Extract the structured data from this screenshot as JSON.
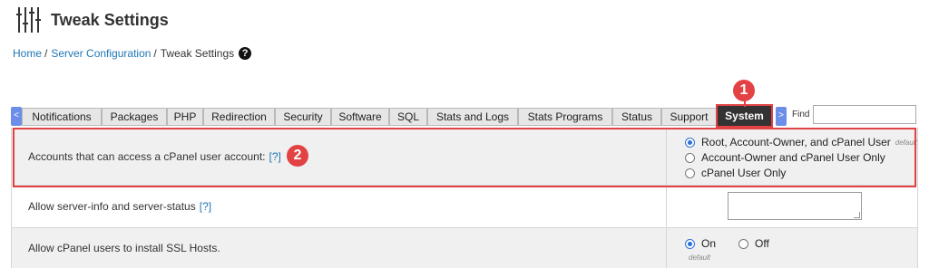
{
  "header": {
    "title": "Tweak Settings",
    "icon": "sliders-icon"
  },
  "breadcrumb": {
    "home": "Home",
    "section": "Server Configuration",
    "current": "Tweak Settings",
    "separator": "/",
    "help_icon": "question-circle-icon",
    "help_glyph": "?"
  },
  "tabs": {
    "scroll_left": "<",
    "scroll_right": ">",
    "items": [
      {
        "label": "Notifications"
      },
      {
        "label": "Packages"
      },
      {
        "label": "PHP"
      },
      {
        "label": "Redirection"
      },
      {
        "label": "Security"
      },
      {
        "label": "Software"
      },
      {
        "label": "SQL"
      },
      {
        "label": "Stats and Logs"
      },
      {
        "label": "Stats Programs"
      },
      {
        "label": "Status"
      },
      {
        "label": "Support"
      },
      {
        "label": "System",
        "active": true
      }
    ],
    "find_label": "Find",
    "find_value": ""
  },
  "settings": [
    {
      "label": "Accounts that can access a cPanel user account:",
      "help": "[?]",
      "options": [
        {
          "label": "Root, Account-Owner, and cPanel User",
          "note": "default",
          "checked": true
        },
        {
          "label": "Account-Owner and cPanel User Only",
          "checked": false
        },
        {
          "label": "cPanel User Only",
          "checked": false
        }
      ]
    },
    {
      "label": "Allow server-info and server-status",
      "help": "[?]",
      "textarea_value": ""
    },
    {
      "label": "Allow cPanel users to install SSL Hosts.",
      "options": [
        {
          "label": "On",
          "checked": true
        },
        {
          "label": "Off",
          "checked": false
        }
      ],
      "default_note": "default"
    }
  ],
  "annotations": {
    "badge1": "1",
    "badge2": "2",
    "color": "#e34245"
  }
}
